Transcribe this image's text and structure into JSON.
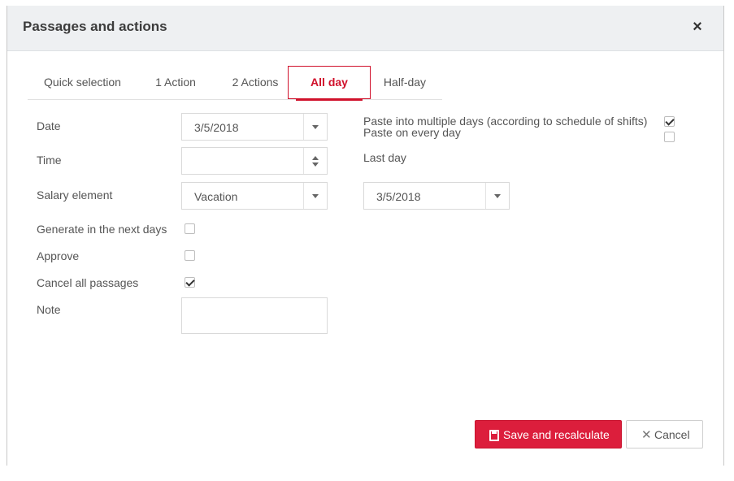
{
  "dialog": {
    "title": "Passages and actions",
    "close_glyph": "×"
  },
  "tabs": [
    {
      "label": "Quick selection",
      "active": false
    },
    {
      "label": "1 Action",
      "active": false
    },
    {
      "label": "2 Actions",
      "active": false
    },
    {
      "label": "All day",
      "active": true
    },
    {
      "label": "Half-day",
      "active": false
    }
  ],
  "form": {
    "date": {
      "label": "Date",
      "value": "3/5/2018"
    },
    "time": {
      "label": "Time",
      "value": ""
    },
    "salary_element": {
      "label": "Salary element",
      "value": "Vacation"
    },
    "generate_next_days": {
      "label": "Generate in the next days",
      "checked": false
    },
    "approve": {
      "label": "Approve",
      "checked": false
    },
    "cancel_all_passages": {
      "label": "Cancel all passages",
      "checked": true
    },
    "note": {
      "label": "Note",
      "value": ""
    }
  },
  "right_panel": {
    "paste_multiple": {
      "label": "Paste into multiple days (according to schedule of shifts)",
      "checked": true
    },
    "paste_every_day": {
      "label": "Paste on every day",
      "checked": false
    },
    "last_day": {
      "label": "Last day",
      "value": "3/5/2018"
    }
  },
  "buttons": {
    "save": "Save and recalculate",
    "cancel": "Cancel",
    "cancel_glyph": "✕"
  },
  "colors": {
    "accent": "#dc1e3c",
    "header_bg": "#eef0f2"
  }
}
